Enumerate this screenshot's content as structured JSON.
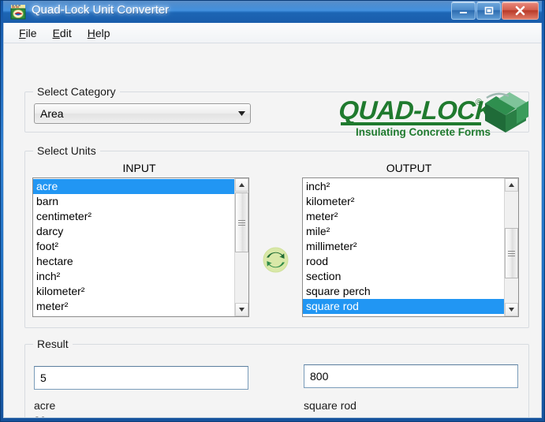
{
  "window": {
    "title": "Quad-Lock Unit Converter",
    "app_icon": "quad-lock-app-icon",
    "caption": {
      "minimize_label": "Minimize",
      "maximize_label": "Maximize",
      "close_label": "Close"
    },
    "colors": {
      "titlebar_blue": "#2472c4",
      "close_red": "#b83a28",
      "selection_blue": "#2196f3",
      "client_bg": "#f4f4f4",
      "logo_green": "#1f7a2e"
    }
  },
  "menubar": {
    "items": [
      {
        "label": "File",
        "mnemonic": "F"
      },
      {
        "label": "Edit",
        "mnemonic": "E"
      },
      {
        "label": "Help",
        "mnemonic": "H"
      }
    ]
  },
  "category": {
    "group_title": "Select Category",
    "selected": "Area",
    "arrow_icon": "chevron-down-icon"
  },
  "logo": {
    "wordmark": "QUAD-LOCK",
    "registered": "®",
    "tagline": "Insulating Concrete Forms"
  },
  "units": {
    "group_title": "Select Units",
    "input": {
      "heading": "INPUT",
      "items": [
        "acre",
        "barn",
        "centimeter²",
        "darcy",
        "foot²",
        "hectare",
        "inch²",
        "kilometer²",
        "meter²"
      ],
      "selected_index": 0,
      "selected_value": "acre",
      "scroll": {
        "up_icon": "triangle-up-icon",
        "down_icon": "triangle-down-icon",
        "thumb_position": "top"
      }
    },
    "output": {
      "heading": "OUTPUT",
      "items": [
        "inch²",
        "kilometer²",
        "meter²",
        "mile²",
        "millimeter²",
        "rood",
        "section",
        "square perch",
        "square rod"
      ],
      "selected_index": 8,
      "selected_value": "square rod",
      "scroll": {
        "up_icon": "triangle-up-icon",
        "down_icon": "triangle-down-icon",
        "thumb_position": "middle"
      }
    },
    "swap_icon": "swap-recycle-arrows-icon"
  },
  "result": {
    "group_title": "Result",
    "input_value": "5",
    "input_unit_name": "acre",
    "input_unit_abbr": "ac",
    "output_value": "800",
    "output_unit_name": "square rod"
  }
}
